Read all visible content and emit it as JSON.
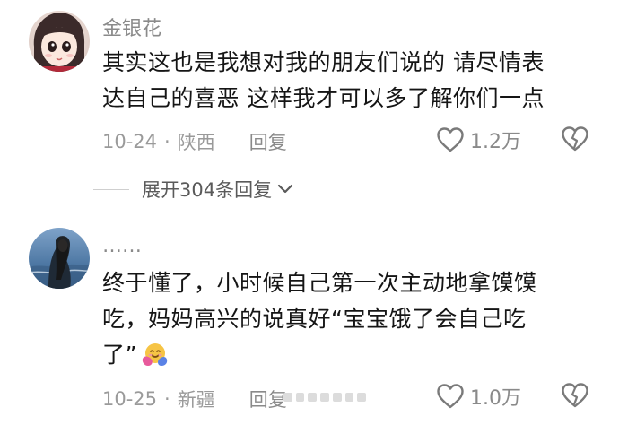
{
  "comments": [
    {
      "username": "金银花",
      "text_lines": [
        "其实这也是我想对我的朋友们说的 请尽情表",
        "达自己的喜恶 这样我才可以多了解你们一点"
      ],
      "date": "10-24",
      "location": "陕西",
      "reply_label": "回复",
      "likes": "1.2万"
    },
    {
      "username": "……",
      "text_lines": [
        "终于懂了，小时候自己第一次主动地拿馍馍",
        "吃，妈妈高兴的说真好“宝宝饿了会自己吃",
        "了”"
      ],
      "date": "10-25",
      "location": "新疆",
      "reply_label": "回复",
      "likes": "1.0万",
      "emoji": "hugging-face-icon"
    }
  ],
  "expand_replies": {
    "label": "展开304条回复"
  },
  "separator": "·",
  "colors": {
    "text": "#151515",
    "meta": "#9a9a9a",
    "username": "#8a8a8a",
    "expand": "#5a5a5a"
  }
}
